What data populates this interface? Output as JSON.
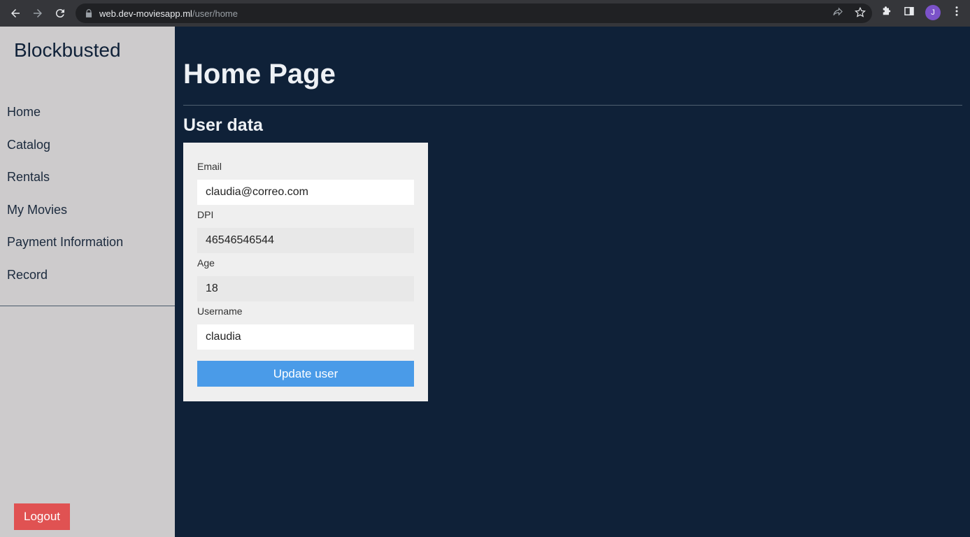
{
  "browser": {
    "url_host": "web.dev-moviesapp.ml",
    "url_path": "/user/home",
    "profile_initial": "J"
  },
  "sidebar": {
    "brand": "Blockbusted",
    "items": [
      {
        "label": "Home"
      },
      {
        "label": "Catalog"
      },
      {
        "label": "Rentals"
      },
      {
        "label": "My Movies"
      },
      {
        "label": "Payment Information"
      },
      {
        "label": "Record"
      }
    ],
    "logout_label": "Logout"
  },
  "main": {
    "page_title": "Home Page",
    "section_title": "User data",
    "form": {
      "email_label": "Email",
      "email_value": "claudia@correo.com",
      "dpi_label": "DPI",
      "dpi_value": "46546546544",
      "age_label": "Age",
      "age_value": "18",
      "username_label": "Username",
      "username_value": "claudia",
      "submit_label": "Update user"
    }
  },
  "colors": {
    "background": "#0f2138",
    "sidebar": "#cdcbcc",
    "card": "#efefef",
    "primary_button": "#4a9be8",
    "logout_button": "#e05252"
  }
}
